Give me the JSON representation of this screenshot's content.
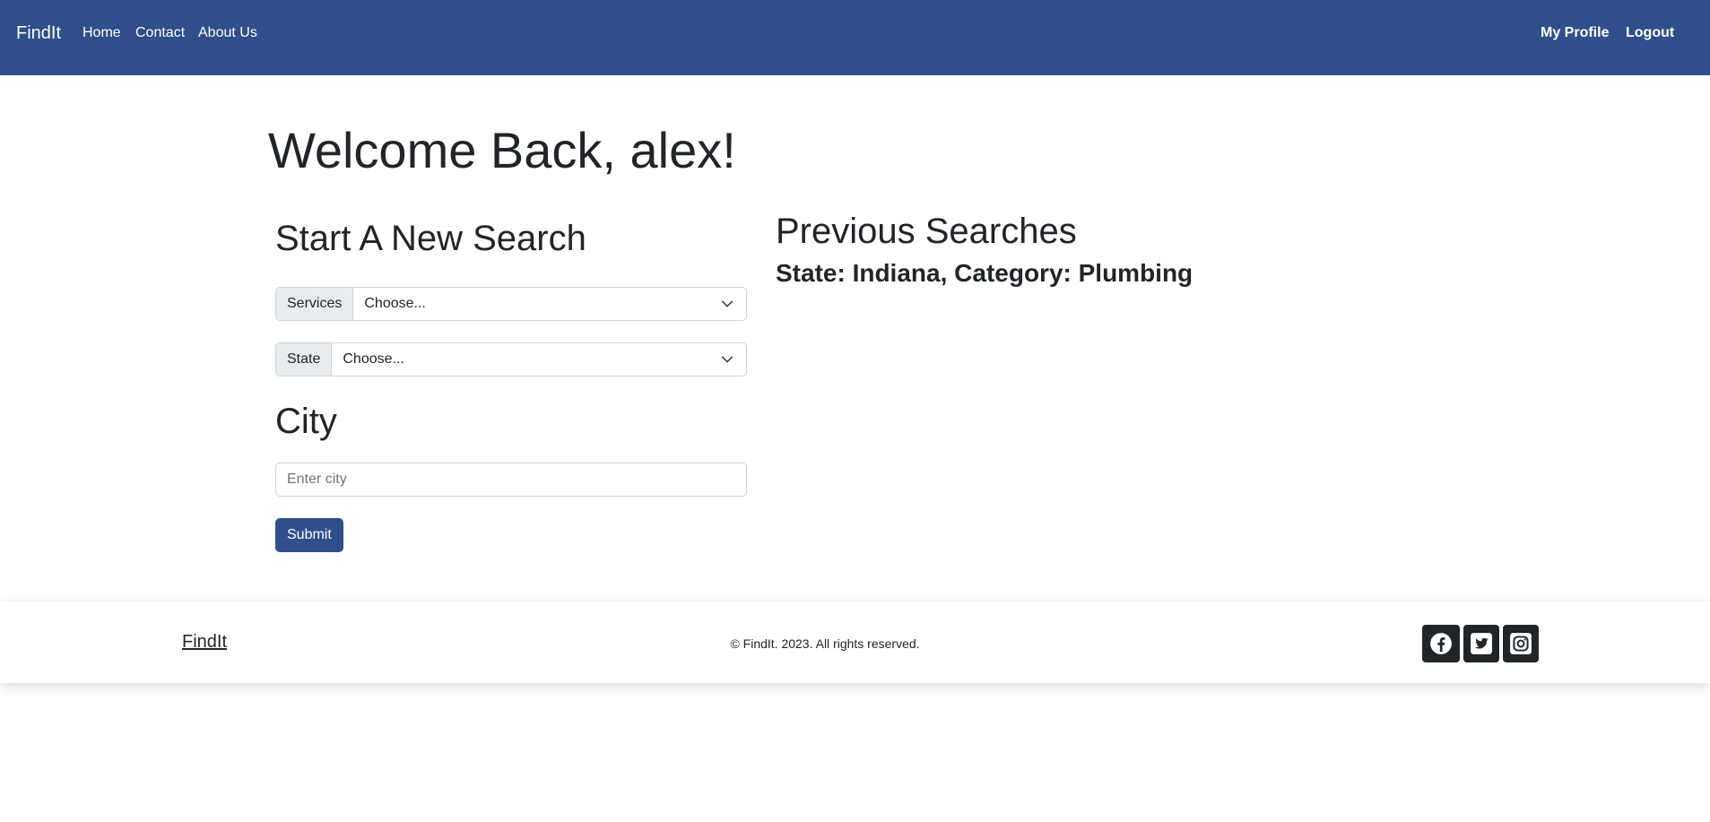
{
  "navbar": {
    "brand": "FindIt",
    "links": [
      "Home",
      "Contact",
      "About Us"
    ],
    "right_links": [
      "My Profile",
      "Logout"
    ],
    "background": "#2f4f8a"
  },
  "main": {
    "welcome": "Welcome Back, alex!",
    "search": {
      "title": "Start A New Search",
      "services_label": "Services",
      "services_value": "Choose...",
      "state_label": "State",
      "state_value": "Choose...",
      "city_title": "City",
      "city_placeholder": "Enter city",
      "submit_label": "Submit"
    },
    "previous": {
      "title": "Previous Searches",
      "items": [
        "State: Indiana, Category: Plumbing"
      ]
    }
  },
  "footer": {
    "brand": "FindIt",
    "copyright": "© FindIt. 2023. All rights reserved.",
    "social_icons": [
      "facebook-icon",
      "twitter-icon",
      "instagram-icon"
    ]
  }
}
